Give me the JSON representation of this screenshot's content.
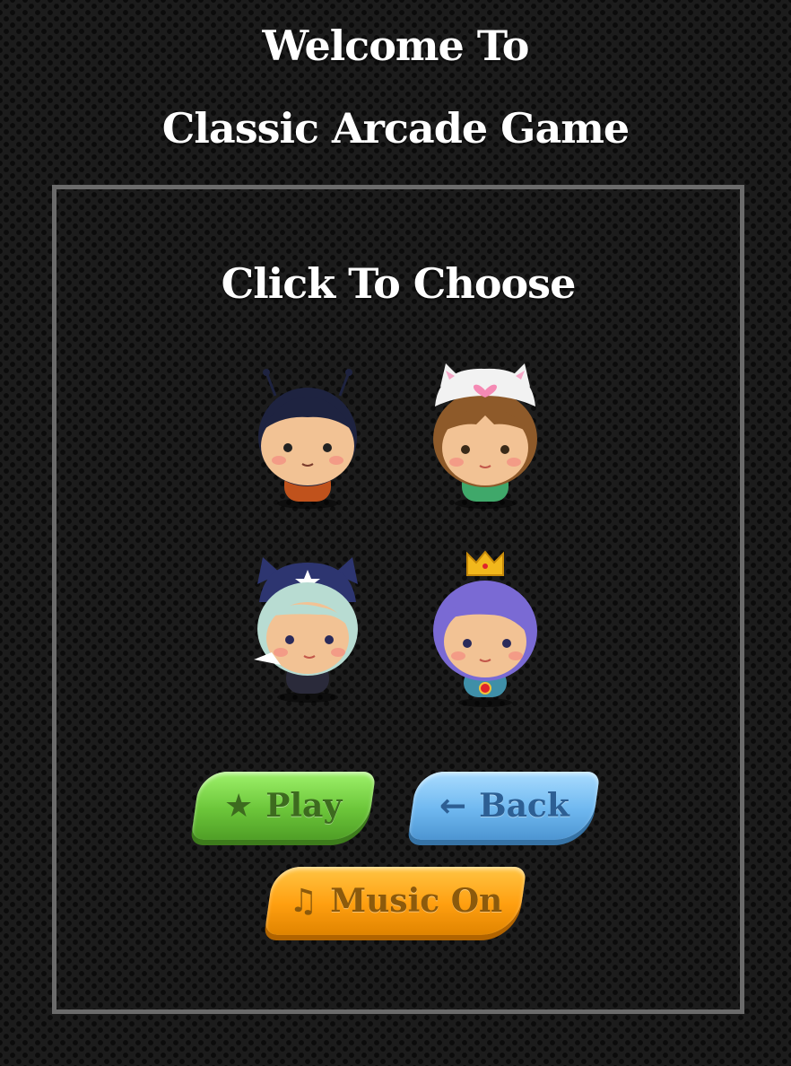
{
  "header": {
    "line1": "Welcome To",
    "line2": "Classic Arcade Game"
  },
  "panel": {
    "heading": "Click To Choose",
    "characters": [
      {
        "id": "boy",
        "icon": "boy-character-icon"
      },
      {
        "id": "cat-girl",
        "icon": "cat-girl-character-icon"
      },
      {
        "id": "horn-girl",
        "icon": "horn-girl-character-icon"
      },
      {
        "id": "princess",
        "icon": "princess-character-icon"
      }
    ]
  },
  "buttons": {
    "play": {
      "label": "Play",
      "icon": "★",
      "color": "#7fd64a"
    },
    "back": {
      "label": "Back",
      "icon": "←",
      "color": "#6fb8f0"
    },
    "music": {
      "label": "Music On",
      "icon": "♫",
      "color": "#ffa51a"
    }
  }
}
